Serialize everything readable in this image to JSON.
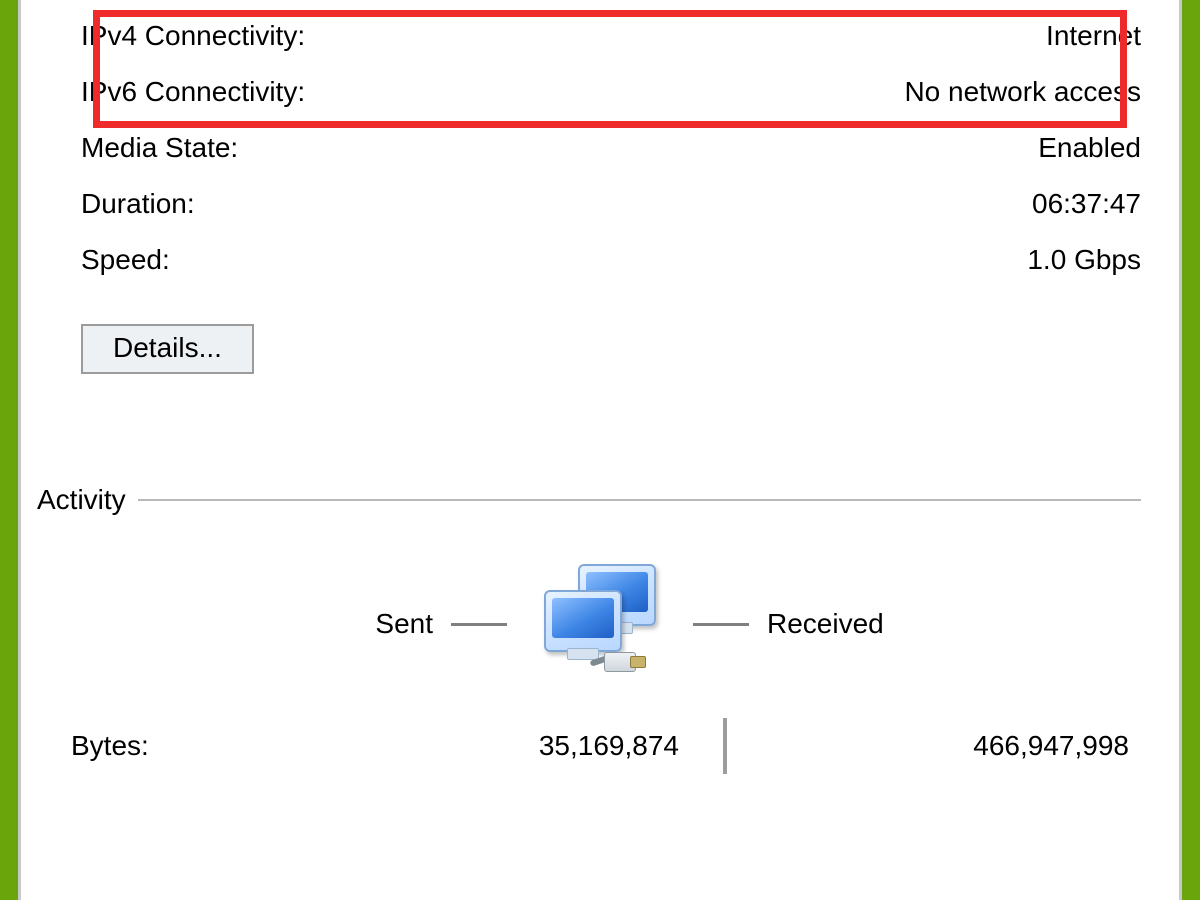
{
  "connection": {
    "rows": [
      {
        "label": "IPv4 Connectivity:",
        "value": "Internet"
      },
      {
        "label": "IPv6 Connectivity:",
        "value": "No network access"
      },
      {
        "label": "Media State:",
        "value": "Enabled"
      },
      {
        "label": "Duration:",
        "value": "06:37:47"
      },
      {
        "label": "Speed:",
        "value": "1.0 Gbps"
      }
    ],
    "details_button": "Details..."
  },
  "activity": {
    "title": "Activity",
    "sent_label": "Sent",
    "received_label": "Received",
    "bytes_label": "Bytes:",
    "bytes_sent": "35,169,874",
    "bytes_received": "466,947,998"
  },
  "annotation": {
    "highlight_color": "#ee2a2a"
  }
}
